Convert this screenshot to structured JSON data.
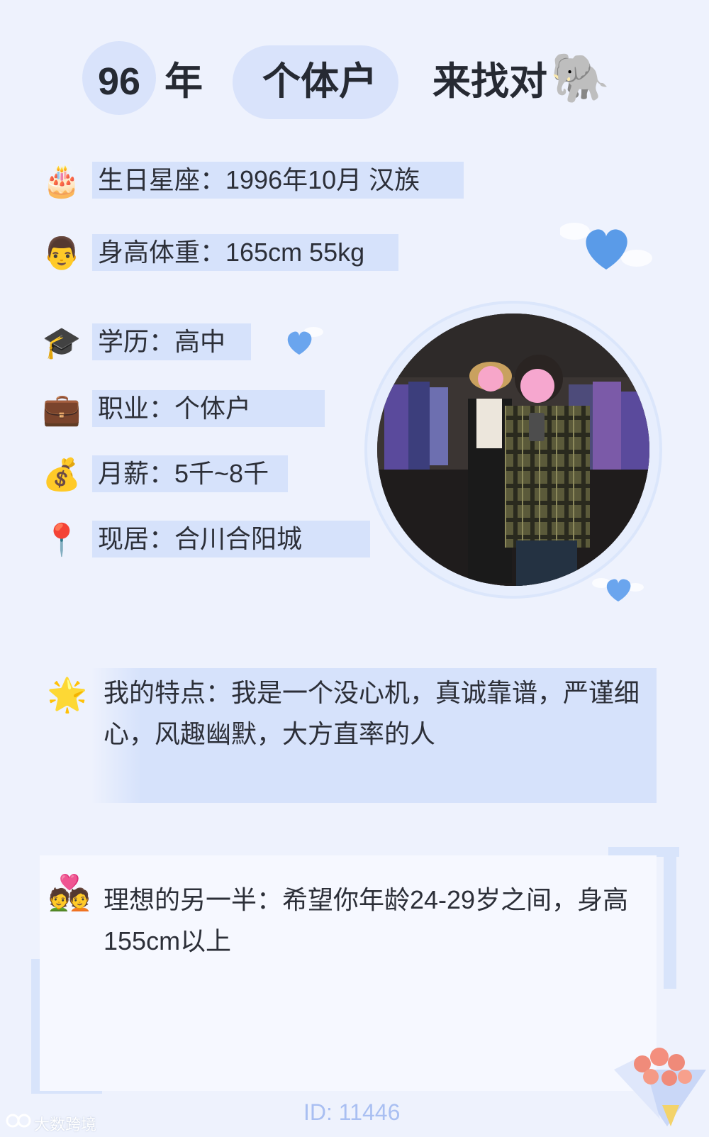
{
  "header": {
    "year": "96",
    "year_suffix": "年",
    "occupation": "个体户",
    "looking_for": "来找对",
    "elephant_emoji": "🐘"
  },
  "info": [
    {
      "icon": "birthday-cake-icon",
      "emoji": "🎂",
      "text": "生日星座：1996年10月 汉族"
    },
    {
      "icon": "man-face-icon",
      "emoji": "👨",
      "text": "身高体重：165cm 55kg"
    },
    {
      "icon": "graduation-cap-icon",
      "emoji": "🎓",
      "text": "学历：高中"
    },
    {
      "icon": "briefcase-icon",
      "emoji": "💼",
      "text": "职业：个体户"
    },
    {
      "icon": "money-bag-icon",
      "emoji": "💰",
      "text": "月薪：5千~8千"
    },
    {
      "icon": "location-pin-icon",
      "emoji": "📍",
      "text": "现居：合川合阳城"
    }
  ],
  "traits": {
    "emoji": "🌟",
    "text": "我的特点：我是一个没心机，真诚靠谱，严谨细心，风趣幽默，大方直率的人"
  },
  "ideal": {
    "emoji": "💑",
    "text": "理想的另一半：希望你年龄24-29岁之间，身高155cm以上"
  },
  "footer": {
    "id_text": "ID: 11446",
    "watermark": "大数跨境"
  },
  "colors": {
    "background": "#eef2fd",
    "highlight": "#d6e2fb",
    "accent_blue": "#5a9be8",
    "id_text": "#a9bff2"
  }
}
